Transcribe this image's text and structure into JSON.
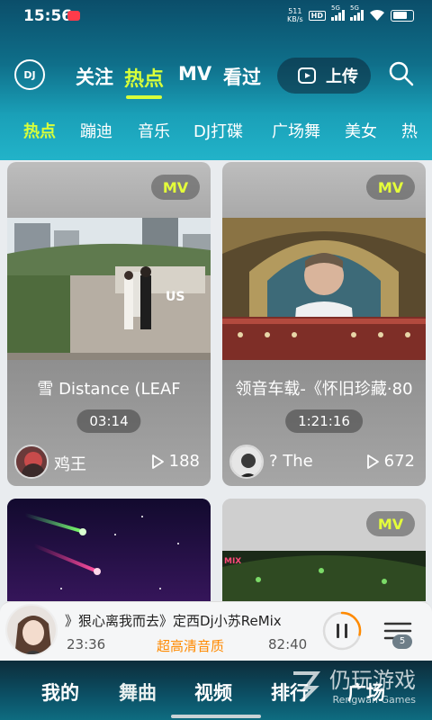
{
  "status_bar": {
    "time": "15:56",
    "net_speed_top": "511",
    "net_speed_bottom": "KB/s",
    "hd_label": "HD",
    "sim1_label": "5G",
    "sim2_label": "5G"
  },
  "header": {
    "logo_text": "DJ",
    "tabs": [
      {
        "label": "关注",
        "active": false
      },
      {
        "label": "热点",
        "active": true
      },
      {
        "label": "MV",
        "active": false
      },
      {
        "label": "看过",
        "active": false
      }
    ],
    "upload_label": "上传"
  },
  "categories": [
    {
      "label": "热点",
      "active": true
    },
    {
      "label": "蹦迪",
      "active": false
    },
    {
      "label": "音乐",
      "active": false
    },
    {
      "label": "DJ打碟",
      "active": false
    },
    {
      "label": "广场舞",
      "active": false
    },
    {
      "label": "美女",
      "active": false
    },
    {
      "label": "热",
      "active": false
    }
  ],
  "cards": [
    {
      "badge": "MV",
      "title": "雪 Distance (LEAF",
      "duration": "03:14",
      "author": "鸡王",
      "plays": "188",
      "overlay_text": "US"
    },
    {
      "badge": "MV",
      "title": "领音车载-《怀旧珍藏·80",
      "duration": "1:21:16",
      "author": "? The",
      "plays": "672"
    },
    {
      "badge": "",
      "title": "",
      "duration": "",
      "author": "",
      "plays": ""
    },
    {
      "badge": "MV",
      "title": "",
      "duration": "",
      "author": "",
      "plays": "",
      "overlay_text": "MIX"
    }
  ],
  "player": {
    "song": "》狠心离我而去》定西Dj小苏ReMix",
    "elapsed": "23:36",
    "quality": "超高清音质",
    "total": "82:40",
    "progress": 0.285,
    "playlist_count": "5"
  },
  "bottom_nav": [
    {
      "label": "我的",
      "active": false
    },
    {
      "label": "舞曲",
      "active": true
    },
    {
      "label": "视频",
      "active": false
    },
    {
      "label": "排行",
      "active": false
    },
    {
      "label": "广场",
      "active": false
    }
  ],
  "watermark": {
    "main": "仍玩游戏",
    "sub": "Rengwan Games"
  },
  "colors": {
    "accent": "#d8ff3a",
    "quality": "#ff8a00",
    "header_top": "#0b4e6a",
    "header_bottom": "#22b3c9"
  }
}
